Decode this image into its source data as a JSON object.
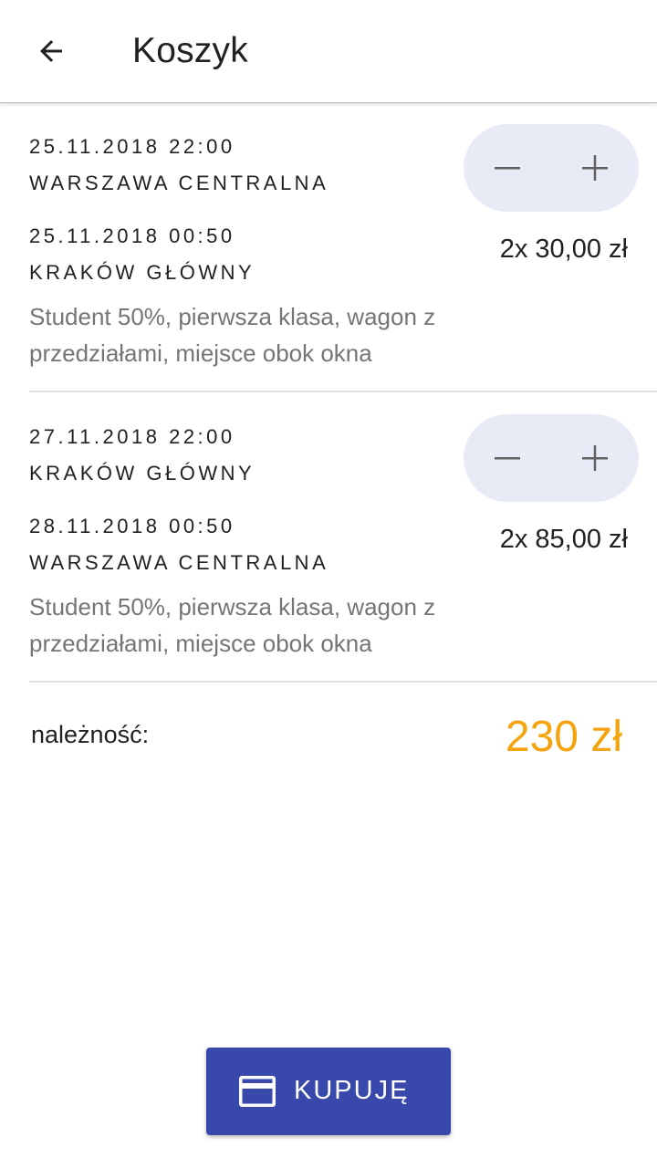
{
  "appbar": {
    "title": "Koszyk",
    "back_icon": "arrow-left-icon"
  },
  "cart": {
    "items": [
      {
        "departure": {
          "datetime": "25.11.2018 22:00",
          "station": "WARSZAWA CENTRALNA"
        },
        "arrival": {
          "datetime": "25.11.2018 00:50",
          "station": "KRAKÓW GŁÓWNY"
        },
        "description": "Student 50%, pierwsza klasa, wagon z przedziałami, miejsce obok okna",
        "price": "2x 30,00 zł",
        "minus_icon": "minus-icon",
        "plus_icon": "plus-icon"
      },
      {
        "departure": {
          "datetime": "27.11.2018 22:00",
          "station": "KRAKÓW GŁÓWNY"
        },
        "arrival": {
          "datetime": "28.11.2018 00:50",
          "station": "WARSZAWA CENTRALNA"
        },
        "description": "Student 50%, pierwsza klasa, wagon z przedziałami, miejsce obok okna",
        "price": "2x 85,00 zł",
        "minus_icon": "minus-icon",
        "plus_icon": "plus-icon"
      }
    ]
  },
  "total": {
    "label": "należność:",
    "amount": "230 zł"
  },
  "buy_button": {
    "label": "KUPUJĘ",
    "icon": "credit-card-icon"
  },
  "colors": {
    "accent": "#3949ab",
    "stepper_bg": "#e8eaf6",
    "total_amount": "#f5a30f",
    "secondary_text": "#757575"
  }
}
